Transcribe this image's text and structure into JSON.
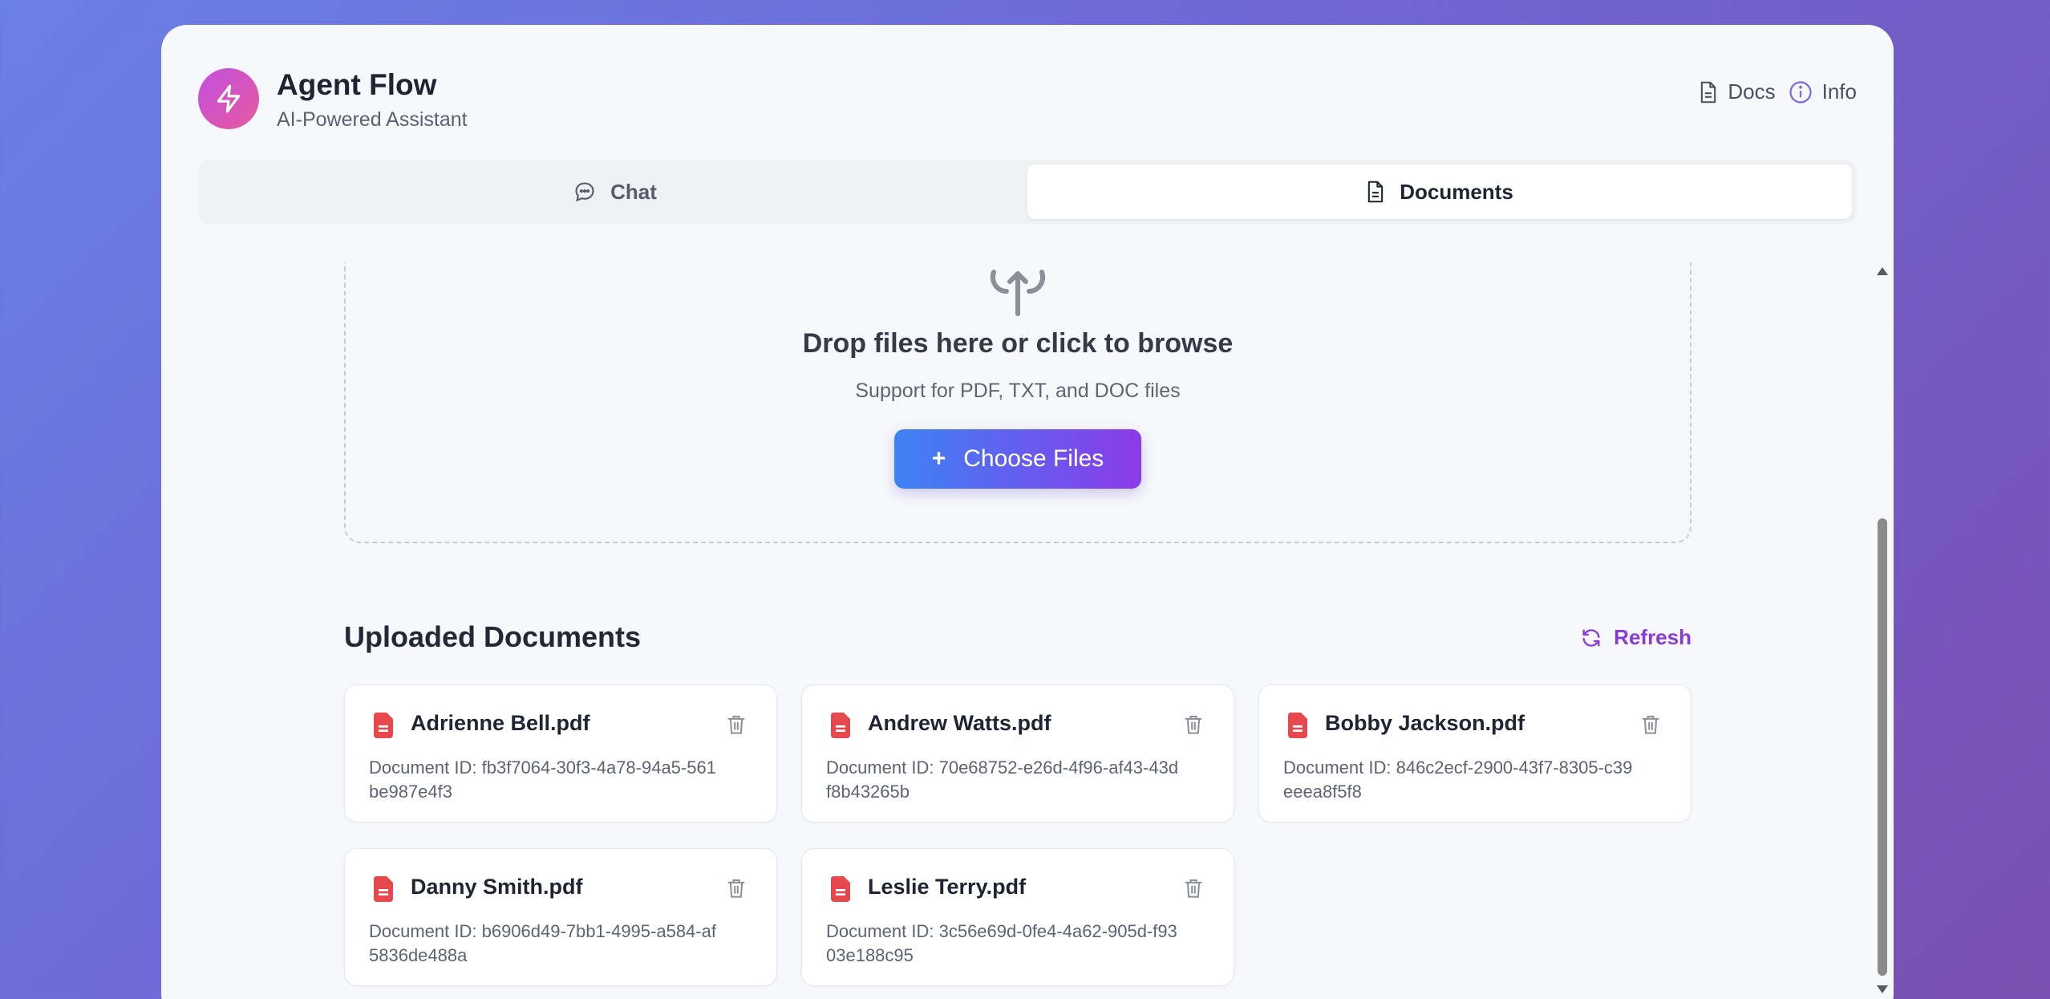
{
  "app": {
    "title": "Agent Flow",
    "subtitle": "AI-Powered Assistant",
    "logo_icon": "lightning-icon"
  },
  "header_links": [
    {
      "label": "Docs",
      "icon": "document-icon"
    },
    {
      "label": "Info",
      "icon": "info-icon"
    }
  ],
  "tabs": [
    {
      "label": "Chat",
      "icon": "chat-bubble-icon",
      "active": false
    },
    {
      "label": "Documents",
      "icon": "document-icon",
      "active": true
    }
  ],
  "upload": {
    "title": "Drop files here or click to browse",
    "subtitle": "Support for PDF, TXT, and DOC files",
    "button_label": "Choose Files",
    "button_icon": "+"
  },
  "documents_section": {
    "title": "Uploaded Documents",
    "refresh_label": "Refresh",
    "items": [
      {
        "name": "Adrienne Bell.pdf",
        "id_text": "Document ID: fb3f7064-30f3-4a78-94a5-561be987e4f3"
      },
      {
        "name": "Andrew Watts.pdf",
        "id_text": "Document ID: 70e68752-e26d-4f96-af43-43df8b43265b"
      },
      {
        "name": "Bobby Jackson.pdf",
        "id_text": "Document ID: 846c2ecf-2900-43f7-8305-c39eeea8f5f8"
      },
      {
        "name": "Danny Smith.pdf",
        "id_text": "Document ID: b6906d49-7bb1-4995-a584-af5836de488a"
      },
      {
        "name": "Leslie Terry.pdf",
        "id_text": "Document ID: 3c56e69d-0fe4-4a62-905d-f9303e188c95"
      }
    ]
  },
  "colors": {
    "accent": "#8a3bd6",
    "button_start": "#3d83f5",
    "button_end": "#8b3ae8",
    "file_icon": "#e5484d"
  }
}
